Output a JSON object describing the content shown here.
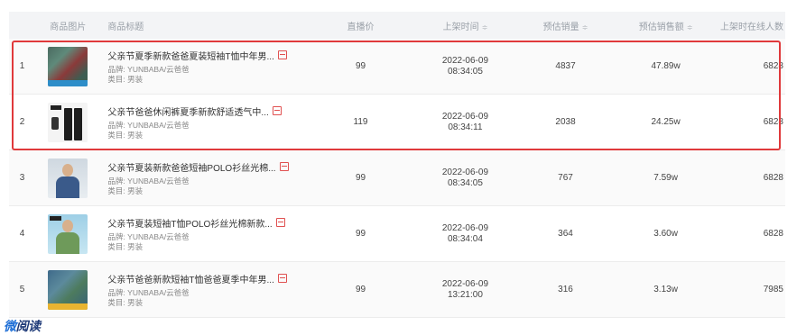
{
  "header": {
    "image": "商品图片",
    "title": "商品标题",
    "price": "直播价",
    "time": "上架时间",
    "sales": "预估销量",
    "amount": "预估销售额",
    "online": "上架时在线人数",
    "sort_glyph": "≑"
  },
  "rows": [
    {
      "idx": "1",
      "title": "父亲节夏季新款爸爸夏装短袖T恤中年男...",
      "brand": "品牌: YUNBABA/云爸爸",
      "category": "类目: 男装",
      "price": "99",
      "date": "2022-06-09",
      "time": "08:34:05",
      "sales": "4837",
      "amount": "47.89w",
      "online": "6828"
    },
    {
      "idx": "2",
      "title": "父亲节爸爸休闲裤夏季新款舒适透气中...",
      "brand": "品牌: YUNBABA/云爸爸",
      "category": "类目: 男装",
      "price": "119",
      "date": "2022-06-09",
      "time": "08:34:11",
      "sales": "2038",
      "amount": "24.25w",
      "online": "6828"
    },
    {
      "idx": "3",
      "title": "父亲节夏装新款爸爸短袖POLO衫丝光棉...",
      "brand": "品牌: YUNBABA/云爸爸",
      "category": "类目: 男装",
      "price": "99",
      "date": "2022-06-09",
      "time": "08:34:05",
      "sales": "767",
      "amount": "7.59w",
      "online": "6828"
    },
    {
      "idx": "4",
      "title": "父亲节夏装短袖T恤POLO衫丝光棉新款...",
      "brand": "品牌: YUNBABA/云爸爸",
      "category": "类目: 男装",
      "price": "99",
      "date": "2022-06-09",
      "time": "08:34:04",
      "sales": "364",
      "amount": "3.60w",
      "online": "6828"
    },
    {
      "idx": "5",
      "title": "父亲节爸爸新款短袖T恤爸爸夏季中年男...",
      "brand": "品牌: YUNBABA/云爸爸",
      "category": "类目: 男装",
      "price": "99",
      "date": "2022-06-09",
      "time": "13:21:00",
      "sales": "316",
      "amount": "3.13w",
      "online": "7985"
    }
  ],
  "icons": {
    "external_link": "external-link-icon",
    "sort": "sort-icon"
  },
  "colors": {
    "highlight": "#e0393b",
    "header_bg": "#f3f4f6",
    "logo": "#1e3a78"
  },
  "footer": {
    "logo_first": "微",
    "logo_rest": "阅读"
  }
}
